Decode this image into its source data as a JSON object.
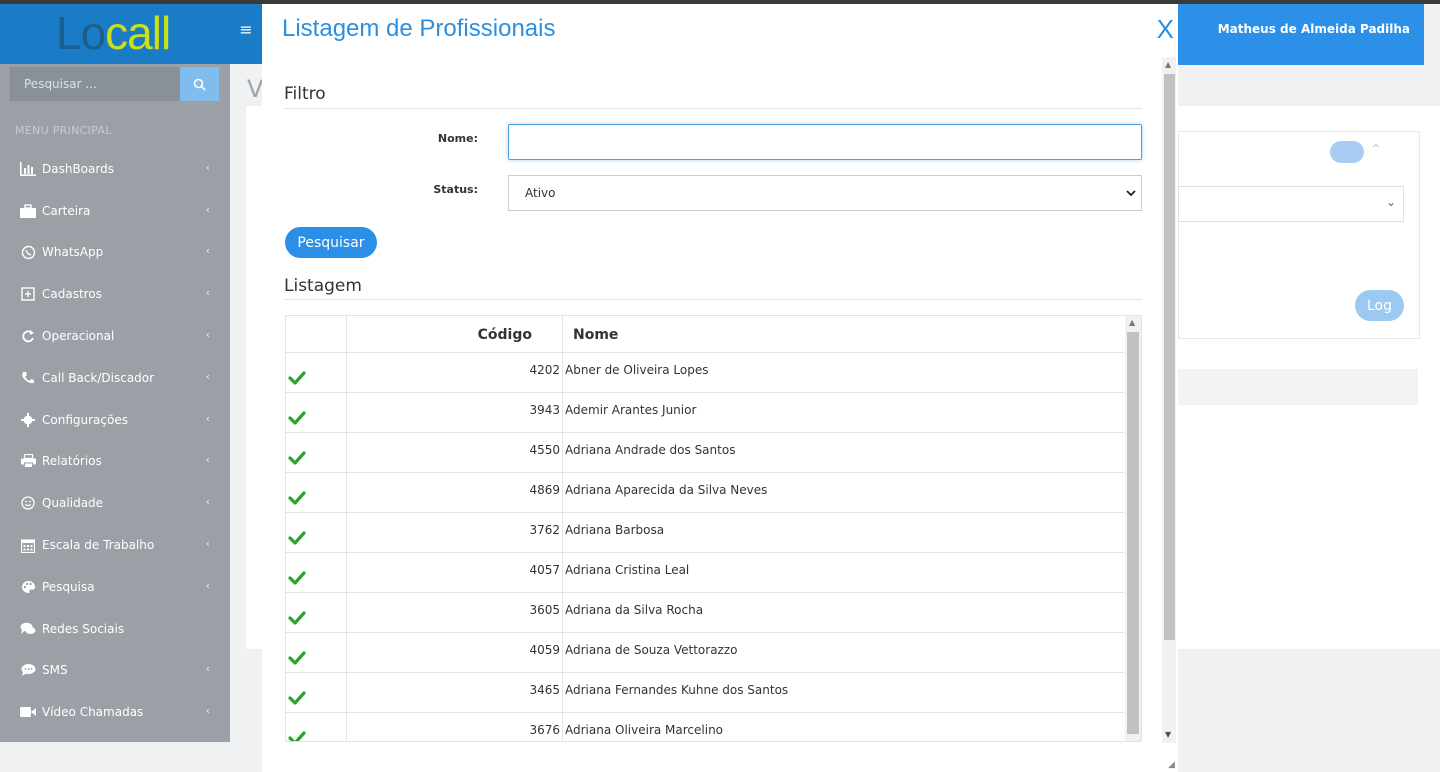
{
  "app": {
    "logo_text_a": "Lo",
    "logo_text_b": "call",
    "user_name": "Matheus de Almeida Padilha"
  },
  "sidebar": {
    "search_placeholder": "Pesquisar ...",
    "menu_header": "MENU PRINCIPAL",
    "items": [
      {
        "label": "DashBoards",
        "icon": "bar-chart-icon",
        "has_submenu": true
      },
      {
        "label": "Carteira",
        "icon": "briefcase-icon",
        "has_submenu": true
      },
      {
        "label": "WhatsApp",
        "icon": "whatsapp-icon",
        "has_submenu": true
      },
      {
        "label": "Cadastros",
        "icon": "plus-square-icon",
        "has_submenu": true
      },
      {
        "label": "Operacional",
        "icon": "refresh-icon",
        "has_submenu": true
      },
      {
        "label": "Call Back/Discador",
        "icon": "phone-icon",
        "has_submenu": true
      },
      {
        "label": "Configurações",
        "icon": "gear-icon",
        "has_submenu": true
      },
      {
        "label": "Relatórios",
        "icon": "printer-icon",
        "has_submenu": true
      },
      {
        "label": "Qualidade",
        "icon": "smile-icon",
        "has_submenu": true
      },
      {
        "label": "Escala de Trabalho",
        "icon": "calendar-icon",
        "has_submenu": true
      },
      {
        "label": "Pesquisa",
        "icon": "palette-icon",
        "has_submenu": true
      },
      {
        "label": "Redes Sociais",
        "icon": "comments-icon",
        "has_submenu": false
      },
      {
        "label": "SMS",
        "icon": "chat-icon",
        "has_submenu": true
      },
      {
        "label": "Vídeo Chamadas",
        "icon": "video-icon",
        "has_submenu": true
      }
    ]
  },
  "background": {
    "page_heading_fragment": "V",
    "log_button": "Log"
  },
  "modal": {
    "title": "Listagem de Profissionais",
    "close_label": "X",
    "filter_section": "Filtro",
    "nome_label": "Nome:",
    "nome_value": "",
    "status_label": "Status:",
    "status_value": "Ativo",
    "search_button": "Pesquisar",
    "list_section": "Listagem",
    "columns": {
      "codigo": "Código",
      "nome": "Nome"
    },
    "rows": [
      {
        "codigo": "4202",
        "nome": "Abner de Oliveira Lopes",
        "active": true
      },
      {
        "codigo": "3943",
        "nome": "Ademir Arantes Junior",
        "active": true
      },
      {
        "codigo": "4550",
        "nome": "Adriana Andrade dos Santos",
        "active": true
      },
      {
        "codigo": "4869",
        "nome": "Adriana Aparecida da Silva Neves",
        "active": true
      },
      {
        "codigo": "3762",
        "nome": "Adriana Barbosa",
        "active": true
      },
      {
        "codigo": "4057",
        "nome": "Adriana Cristina Leal",
        "active": true
      },
      {
        "codigo": "3605",
        "nome": "Adriana da Silva Rocha",
        "active": true
      },
      {
        "codigo": "4059",
        "nome": "Adriana de Souza Vettorazzo",
        "active": true
      },
      {
        "codigo": "3465",
        "nome": "Adriana Fernandes Kuhne dos Santos",
        "active": true
      },
      {
        "codigo": "3676",
        "nome": "Adriana Oliveira Marcelino",
        "active": true
      }
    ]
  },
  "colors": {
    "brand": "#1a7cc7",
    "accent": "#2b8fe8",
    "sidebar": "#9aa0a6",
    "check": "#2e9e2e"
  }
}
